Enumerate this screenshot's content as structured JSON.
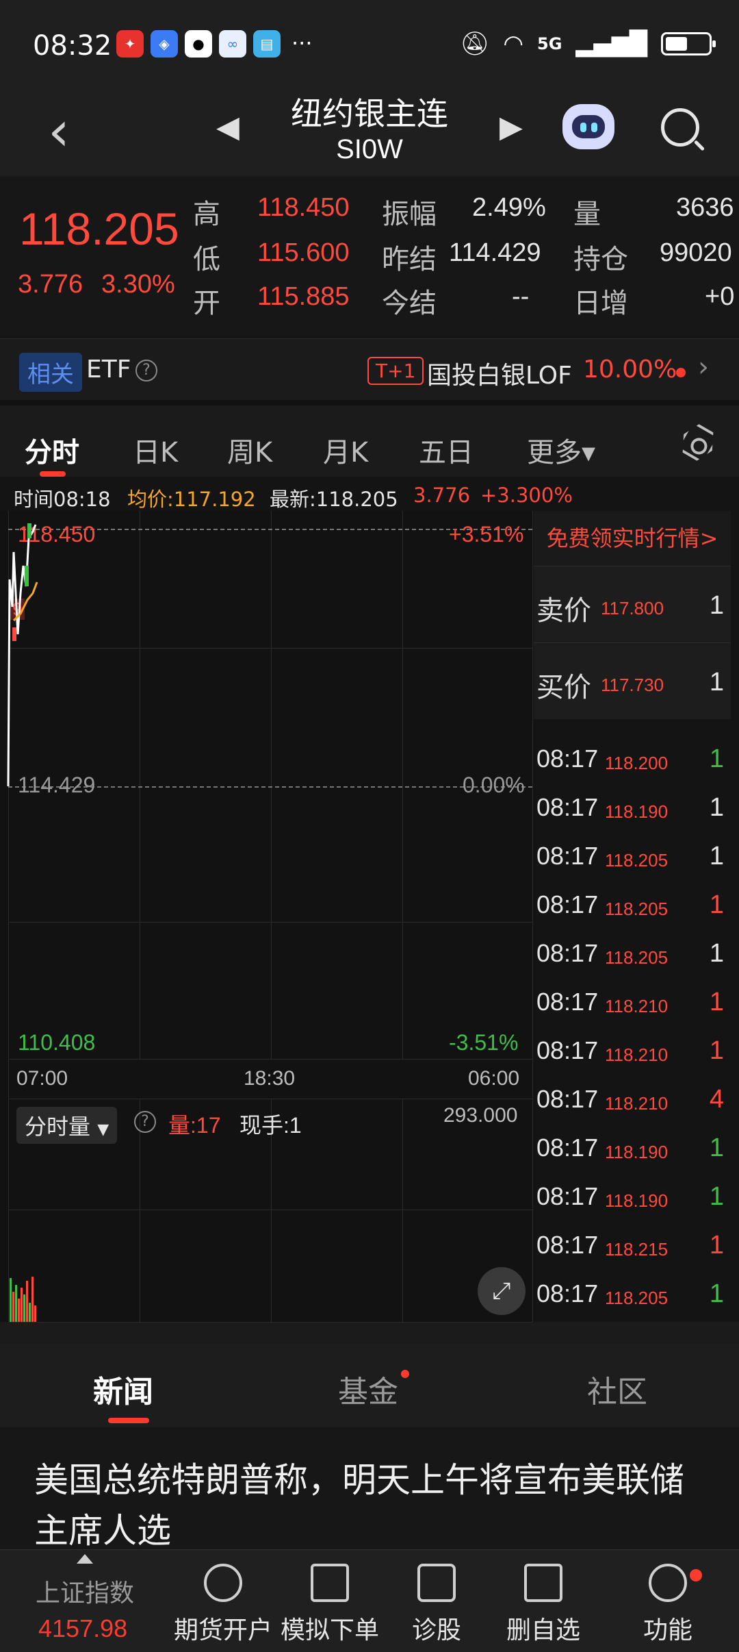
{
  "status_bar": {
    "time": "08:32",
    "app_icons": [
      "red-app-icon",
      "app-market-icon",
      "qq-icon",
      "browser-icon",
      "reader-icon"
    ],
    "more": "···",
    "network": "5G",
    "battery_level": 0.5
  },
  "header": {
    "title": "纽约银主连",
    "subtitle": "SI0W"
  },
  "quote": {
    "price": "118.205",
    "change": "3.776",
    "change_pct": "3.30%",
    "high_label": "高",
    "high": "118.450",
    "low_label": "低",
    "low": "115.600",
    "open_label": "开",
    "open": "115.885",
    "amplitude_label": "振幅",
    "amplitude": "2.49%",
    "prev_settle_label": "昨结",
    "prev_settle": "114.429",
    "today_settle_label": "今结",
    "today_settle": "--",
    "volume_label": "量",
    "volume": "3636",
    "open_interest_label": "持仓",
    "open_interest": "99020",
    "daily_increase_label": "日增",
    "daily_increase": "+0"
  },
  "etf_bar": {
    "tag": "相关",
    "label": "ETF",
    "help": "?",
    "badge": "T+1",
    "fund_name": "国投白银LOF",
    "fund_change": "10.00%"
  },
  "tabs": [
    "分时",
    "日K",
    "周K",
    "月K",
    "五日",
    "更多▾"
  ],
  "info_row": {
    "time": "时间08:18",
    "avg": "均价:117.192",
    "latest": "最新:118.205",
    "change": "3.776",
    "change_pct": "+3.300%"
  },
  "chart": {
    "upper_price": "118.450",
    "upper_pct": "+3.51%",
    "mid_price": "114.429",
    "mid_pct": "0.00%",
    "lower_price": "110.408",
    "lower_pct": "-3.51%",
    "x_start": "07:00",
    "x_mid": "18:30",
    "x_end": "06:00",
    "side_marker": "9",
    "volume_selector": "分时量",
    "volume_label": "量:17",
    "hand_label": "现手:1",
    "volume_max": "293.000"
  },
  "order_book": {
    "promo": "免费领实时行情>",
    "ask_label": "卖价",
    "ask_price": "117.800",
    "ask_volume": "1",
    "bid_label": "买价",
    "bid_price": "117.730",
    "bid_volume": "1"
  },
  "ticks": [
    {
      "time": "08:17",
      "price": "118.205",
      "volume": "1",
      "color": "#ff4a3d"
    },
    {
      "time": "08:17",
      "price": "118.200",
      "volume": "1",
      "color": "#3fbf4a"
    },
    {
      "time": "08:17",
      "price": "118.190",
      "volume": "1",
      "color": "#e6e6e6"
    },
    {
      "time": "08:17",
      "price": "118.205",
      "volume": "1",
      "color": "#e6e6e6"
    },
    {
      "time": "08:17",
      "price": "118.205",
      "volume": "1",
      "color": "#ff4a3d"
    },
    {
      "time": "08:17",
      "price": "118.205",
      "volume": "1",
      "color": "#e6e6e6"
    },
    {
      "time": "08:17",
      "price": "118.210",
      "volume": "1",
      "color": "#ff4a3d"
    },
    {
      "time": "08:17",
      "price": "118.210",
      "volume": "1",
      "color": "#ff4a3d"
    },
    {
      "time": "08:17",
      "price": "118.210",
      "volume": "4",
      "color": "#ff4a3d"
    },
    {
      "time": "08:17",
      "price": "118.190",
      "volume": "1",
      "color": "#3fbf4a"
    },
    {
      "time": "08:17",
      "price": "118.190",
      "volume": "1",
      "color": "#3fbf4a"
    },
    {
      "time": "08:17",
      "price": "118.215",
      "volume": "1",
      "color": "#ff4a3d"
    },
    {
      "time": "08:17",
      "price": "118.205",
      "volume": "1",
      "color": "#3fbf4a"
    }
  ],
  "news_tabs": [
    "新闻",
    "基金",
    "社区"
  ],
  "headline": "美国总统特朗普称，明天上午将宣布美联储主席人选",
  "bottom_bar": {
    "index_name": "上证指数",
    "index_value": "4157.98",
    "items": [
      "期货开户",
      "模拟下单",
      "诊股",
      "删自选",
      "功能"
    ]
  },
  "colors": {
    "up": "#ff4a3d",
    "down": "#3fbf4a",
    "avg_line": "#f5a623",
    "accent_blue": "#5c8ef0"
  }
}
